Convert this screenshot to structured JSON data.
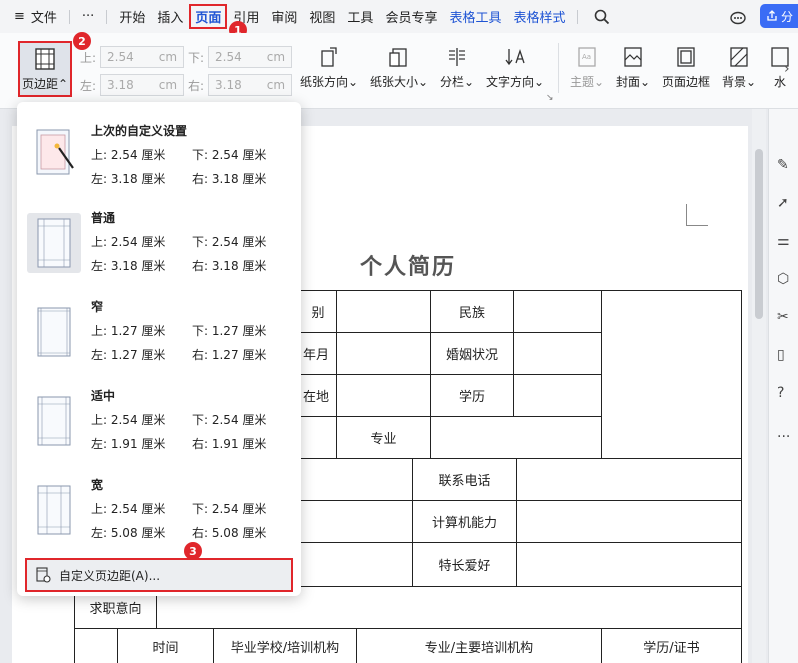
{
  "menubar": {
    "menu_icon": "≡",
    "file": "文件",
    "more": "···",
    "tabs": [
      "开始",
      "插入",
      "页面",
      "引用",
      "审阅",
      "视图",
      "工具",
      "会员专享"
    ],
    "active_tab": "页面",
    "context_tabs": [
      "表格工具",
      "表格样式"
    ],
    "share": "分"
  },
  "ribbon": {
    "margins_label": "页边距",
    "top_label": "上:",
    "bottom_label": "下:",
    "left_label": "左:",
    "right_label": "右:",
    "top_value": "2.54",
    "bottom_value": "2.54",
    "left_value": "3.18",
    "right_value": "3.18",
    "unit": "cm",
    "orientation": "纸张方向",
    "size": "纸张大小",
    "columns": "分栏",
    "text_direction": "文字方向",
    "theme": "主题",
    "cover": "封面",
    "page_border": "页面边框",
    "background": "背景",
    "watermark": "水"
  },
  "badges": [
    "1",
    "2",
    "3"
  ],
  "dropdown": {
    "presets": [
      {
        "name": "上次的自定义设置",
        "top": "上: 2.54 厘米",
        "bottom": "下: 2.54 厘米",
        "left": "左: 3.18 厘米",
        "right": "右: 3.18 厘米"
      },
      {
        "name": "普通",
        "top": "上: 2.54 厘米",
        "bottom": "下: 2.54 厘米",
        "left": "左: 3.18 厘米",
        "right": "右: 3.18 厘米"
      },
      {
        "name": "窄",
        "top": "上: 1.27 厘米",
        "bottom": "下: 1.27 厘米",
        "left": "左: 1.27 厘米",
        "right": "右: 1.27 厘米"
      },
      {
        "name": "适中",
        "top": "上: 2.54 厘米",
        "bottom": "下: 2.54 厘米",
        "left": "左: 1.91 厘米",
        "right": "右: 1.91 厘米"
      },
      {
        "name": "宽",
        "top": "上: 2.54 厘米",
        "bottom": "下: 2.54 厘米",
        "left": "左: 5.08 厘米",
        "right": "右: 5.08 厘米"
      }
    ],
    "custom_label": "自定义页边距(A)..."
  },
  "document": {
    "title": "个人简历",
    "cells": {
      "gender_fragment": "别",
      "ethnicity": "民族",
      "birth_fragment": "年月",
      "marital": "婚姻状况",
      "origin_fragment": "在地",
      "education": "学历",
      "major": "专业",
      "phone": "联系电话",
      "computer": "计算机能力",
      "hobby": "特长爱好",
      "objective": "求职意向",
      "time": "时间",
      "school": "毕业学校/培训机构",
      "major_training": "专业/主要培训机构",
      "degree": "学历/证书"
    }
  }
}
